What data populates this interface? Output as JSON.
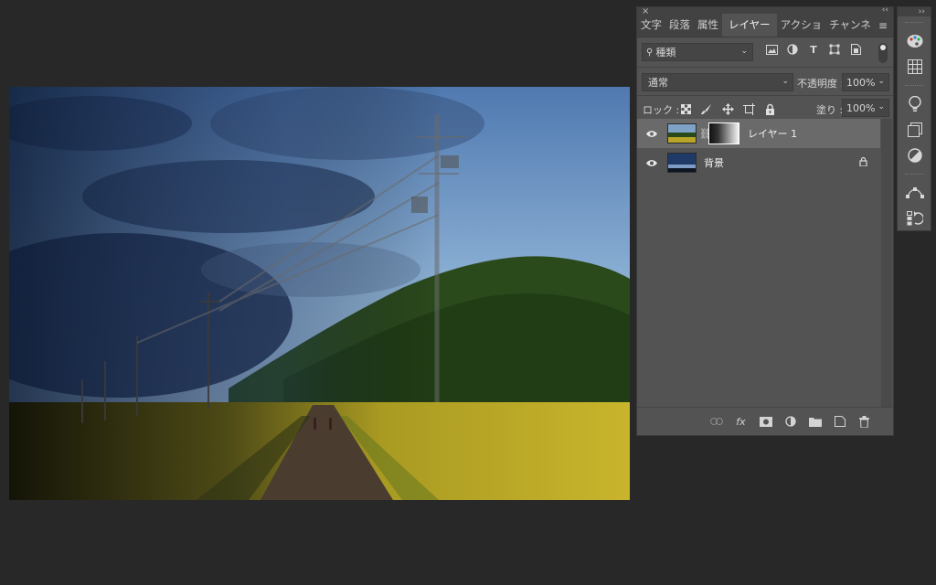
{
  "panel": {
    "tabs": [
      {
        "label": "文字"
      },
      {
        "label": "段落"
      },
      {
        "label": "属性"
      },
      {
        "label": "レイヤー"
      },
      {
        "label": "アクショ"
      },
      {
        "label": "チャンネ"
      }
    ],
    "close_glyph": "×",
    "collapse_glyph": "‹‹",
    "menu_glyph": "≡",
    "filter": {
      "label": "種類"
    },
    "blend_mode": "通常",
    "opacity_label": "不透明度 :",
    "opacity_value": "100%",
    "lock_label": "ロック :",
    "fill_label": "塗り :",
    "fill_value": "100%",
    "layers": [
      {
        "name": "レイヤー 1",
        "selected": true,
        "has_mask": true
      },
      {
        "name": "背景",
        "selected": false,
        "locked": true
      }
    ]
  },
  "strip": {
    "collapse_glyph": "››"
  },
  "icons": {
    "filter": [
      "image-filter-icon",
      "adjustment-filter-icon",
      "type-filter-icon",
      "shape-filter-icon",
      "smart-object-filter-icon"
    ],
    "lock": [
      "lock-transparent-pixels-icon",
      "lock-image-pixels-icon",
      "lock-position-icon",
      "lock-artboard-icon",
      "lock-all-icon"
    ],
    "bottom": [
      "link-layers-icon",
      "layer-style-icon",
      "add-mask-icon",
      "new-adjustment-layer-icon",
      "new-group-icon",
      "new-layer-icon",
      "delete-layer-icon"
    ],
    "strip": [
      "color-palette-icon",
      "swatches-grid-icon",
      "lightbulb-icon",
      "libraries-icon",
      "adjustments-icon",
      "paths-icon",
      "history-icon"
    ]
  },
  "colors": {
    "selected_layer": "#6a6a6a",
    "panel_bg": "#535353",
    "app_bg": "#282828"
  }
}
